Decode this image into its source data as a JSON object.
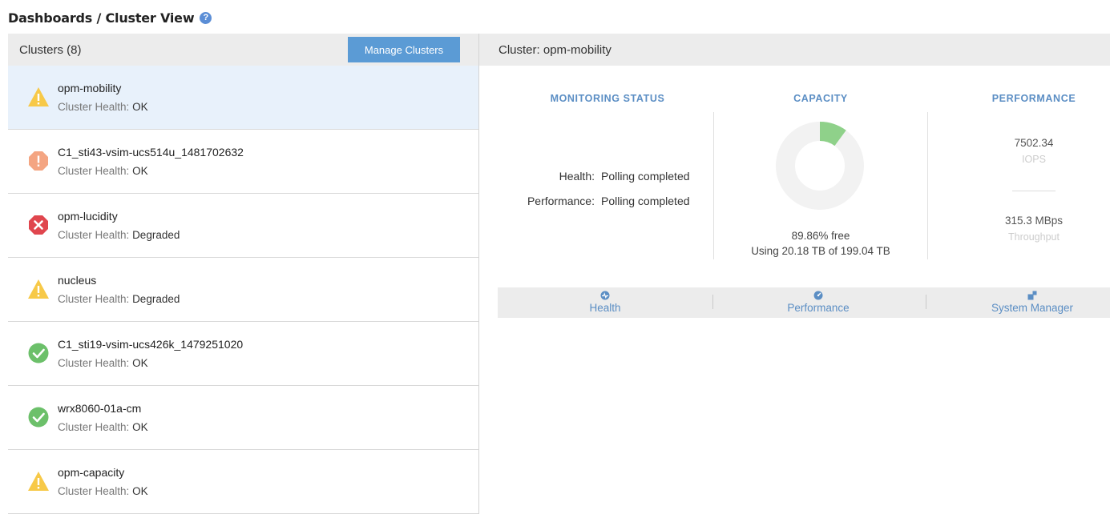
{
  "header": {
    "title": "Dashboards / Cluster View",
    "help_symbol": "?"
  },
  "clusters_panel": {
    "count_label": "Clusters (8)",
    "manage_button": "Manage Clusters",
    "health_prefix": "Cluster Health:",
    "items": [
      {
        "name": "opm-mobility",
        "health": "OK",
        "status": "warning",
        "selected": true
      },
      {
        "name": "C1_sti43-vsim-ucs514u_1481702632",
        "health": "OK",
        "status": "minor-warning"
      },
      {
        "name": "opm-lucidity",
        "health": "Degraded",
        "status": "error"
      },
      {
        "name": "nucleus",
        "health": "Degraded",
        "status": "warning"
      },
      {
        "name": "C1_sti19-vsim-ucs426k_1479251020",
        "health": "OK",
        "status": "ok"
      },
      {
        "name": "wrx8060-01a-cm",
        "health": "OK",
        "status": "ok"
      },
      {
        "name": "opm-capacity",
        "health": "OK",
        "status": "warning"
      }
    ]
  },
  "detail": {
    "title": "Cluster: opm-mobility",
    "monitoring": {
      "title": "MONITORING STATUS",
      "rows": [
        {
          "label": "Health:",
          "value": "Polling completed"
        },
        {
          "label": "Performance:",
          "value": "Polling completed"
        }
      ]
    },
    "capacity": {
      "title": "CAPACITY",
      "free_text": "89.86% free",
      "usage_text": "Using 20.18 TB of 199.04 TB",
      "used_fraction": 0.1014,
      "used_color": "#8fd18a",
      "free_color": "#f2f2f2"
    },
    "performance": {
      "title": "PERFORMANCE",
      "iops_value": "7502.34",
      "iops_unit": "IOPS",
      "throughput_value": "315.3 MBps",
      "throughput_unit": "Throughput"
    },
    "links": [
      {
        "label": "Health",
        "icon": "health-icon"
      },
      {
        "label": "Performance",
        "icon": "performance-icon"
      },
      {
        "label": "System Manager",
        "icon": "system-manager-icon"
      }
    ]
  },
  "colors": {
    "warning": "#f7c948",
    "minor-warning": "#f4a582",
    "error": "#e0464e",
    "ok": "#6cc06a",
    "accent": "#5b9bd5"
  }
}
